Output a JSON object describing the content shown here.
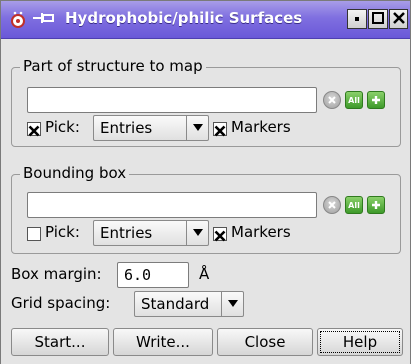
{
  "window": {
    "title": "Hydrophobic/philic Surfaces",
    "icons": {
      "app": "app-icon",
      "pin": "pin-icon",
      "minimize": "minimize-icon",
      "maximize": "maximize-icon",
      "close": "close-icon"
    }
  },
  "structure_group": {
    "title": "Part of structure to map",
    "entry_value": "",
    "clear_icon": "clear-icon",
    "all_label": "All",
    "add_icon": "plus-icon",
    "pick_checked": true,
    "pick_label": "Pick:",
    "pick_select": "Entries",
    "markers_checked": true,
    "markers_label": "Markers"
  },
  "bbox_group": {
    "title": "Bounding box",
    "entry_value": "",
    "clear_icon": "clear-icon",
    "all_label": "All",
    "add_icon": "plus-icon",
    "pick_checked": false,
    "pick_label": "Pick:",
    "pick_select": "Entries",
    "markers_checked": true,
    "markers_label": "Markers"
  },
  "box_margin": {
    "label": "Box margin:",
    "value": "6.0",
    "unit": "Å"
  },
  "grid_spacing": {
    "label": "Grid spacing:",
    "value": "Standard"
  },
  "buttons": {
    "start": "Start...",
    "write": "Write...",
    "close": "Close",
    "help": "Help"
  },
  "colors": {
    "titlebar": "#7f6fe0",
    "green_button": "#3e9a2a",
    "background": "#e4e4e4"
  }
}
